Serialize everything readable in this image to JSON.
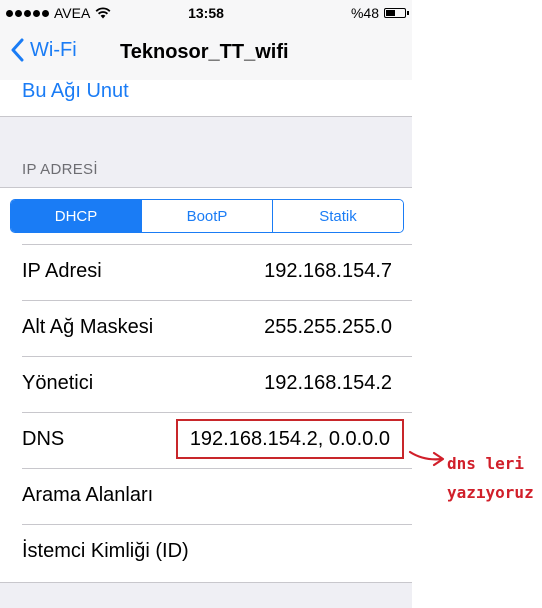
{
  "status_bar": {
    "carrier": "AVEA",
    "time": "13:58",
    "battery_percent": "%48",
    "battery_level": 0.48
  },
  "nav": {
    "back_label": "Wi-Fi",
    "title": "Teknosor_TT_wifi"
  },
  "forget_network_label": "Bu Ağı Unut",
  "ip_section": {
    "header": "IP ADRESİ",
    "segments": [
      {
        "label": "DHCP",
        "active": true
      },
      {
        "label": "BootP",
        "active": false
      },
      {
        "label": "Statik",
        "active": false
      }
    ],
    "rows": [
      {
        "label": "IP Adresi",
        "value": "192.168.154.7"
      },
      {
        "label": "Alt Ağ Maskesi",
        "value": "255.255.255.0"
      },
      {
        "label": "Yönetici",
        "value": "192.168.154.2"
      },
      {
        "label": "DNS",
        "value": "192.168.154.2, 0.0.0.0"
      },
      {
        "label": "Arama Alanları",
        "value": ""
      },
      {
        "label": "İstemci Kimliği (ID)",
        "value": ""
      }
    ]
  },
  "annotation": {
    "line1": "dns leri",
    "line2": "yazıyoruz",
    "color": "#d11f2a"
  },
  "colors": {
    "ios_blue": "#1a7cf5",
    "highlight_red": "#c8262a"
  },
  "icons": {
    "signal": "signal-dots-icon",
    "wifi": "wifi-icon",
    "battery": "battery-icon",
    "back": "chevron-left-icon",
    "annotation_arrow": "arrow-right-icon"
  }
}
